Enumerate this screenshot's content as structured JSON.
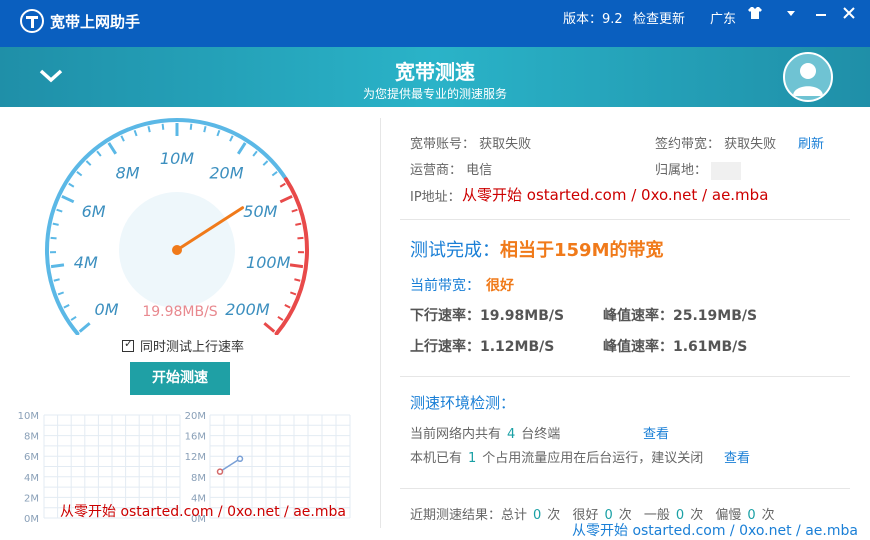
{
  "titlebar": {
    "app_title": "宽带上网助手",
    "version": "版本：9.2",
    "check_update": "检查更新",
    "region": "广东",
    "skin_icon": "shirt-icon",
    "menu_icon": "chevron-down-icon",
    "minimize_icon": "minimize-icon",
    "close_icon": "close-icon"
  },
  "header": {
    "title": "宽带测速",
    "subtitle": "为您提供最专业的测速服务"
  },
  "gauge": {
    "labels": [
      "0M",
      "4M",
      "6M",
      "8M",
      "10M",
      "20M",
      "50M",
      "100M",
      "200M"
    ],
    "current_speed": "19.98MB/S",
    "needle_value_fraction": 0.72,
    "colors": {
      "normal": "#5bb8e6",
      "high": "#e84a4a",
      "needle": "#f07a1a"
    }
  },
  "options": {
    "upload_test_label": "同时测试上行速率",
    "upload_test_checked": true,
    "start_button": "开始测速"
  },
  "mini_chart": {
    "left_ticks": [
      "10M",
      "8M",
      "6M",
      "4M",
      "2M",
      "0M"
    ],
    "right_ticks": [
      "20M",
      "16M",
      "12M",
      "8M",
      "4M",
      "0M"
    ]
  },
  "chart_data": {
    "type": "line",
    "ylim_left": [
      0,
      10
    ],
    "ylim_right": [
      0,
      20
    ],
    "series": [
      {
        "values": [
          9,
          11.5
        ],
        "color": "#7aa0d6"
      }
    ]
  },
  "account": {
    "account_label": "宽带账号：",
    "account_value": "获取失败",
    "contract_label": "签约带宽：",
    "contract_value": "获取失败",
    "refresh": "刷新",
    "isp_label": "运营商：",
    "isp_value": "电信",
    "location_label": "归属地：",
    "ip_label": "IP地址："
  },
  "result": {
    "title_prefix": "测试完成：",
    "title_highlight": "相当于159M的带宽",
    "current_bw_label": "当前带宽：",
    "current_bw_value": "很好",
    "down_label": "下行速率：",
    "down_value": "19.98MB/S",
    "down_peak_label": "峰值速率：",
    "down_peak_value": "25.19MB/S",
    "up_label": "上行速率：",
    "up_value": "1.12MB/S",
    "up_peak_label": "峰值速率：",
    "up_peak_value": "1.61MB/S"
  },
  "env": {
    "title": "测速环境检测：",
    "net_prefix": "当前网络内共有",
    "net_count": "4",
    "net_suffix": "台终端",
    "view1": "查看",
    "local_prefix": "本机已有",
    "local_count": "1",
    "local_suffix": "个占用流量应用在后台运行，建议关闭",
    "view2": "查看"
  },
  "recent": {
    "label": "近期测速结果：总计",
    "total": "0",
    "unit1": "次",
    "good_label": "很好",
    "good": "0",
    "unit2": "次",
    "avg_label": "一般",
    "avg": "0",
    "unit3": "次",
    "slow_label": "偏慢",
    "slow": "0",
    "unit4": "次"
  },
  "watermark": "从零开始 ostarted.com / 0xo.net / ae.mba"
}
